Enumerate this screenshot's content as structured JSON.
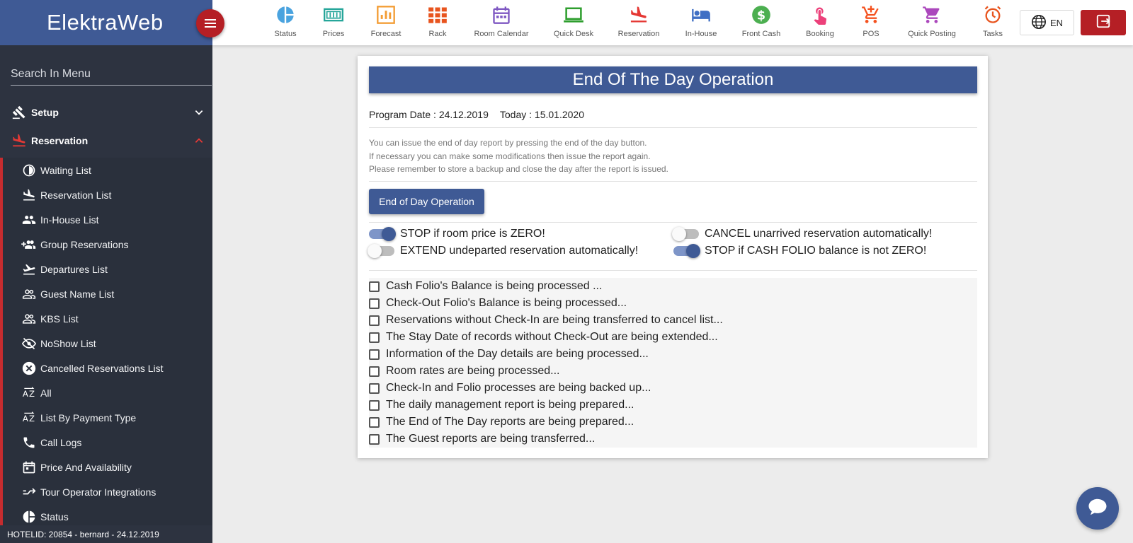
{
  "brand": {
    "name": "ElektraWeb"
  },
  "sidebar": {
    "search_placeholder": "Search In Menu",
    "sections": [
      {
        "label": "Setup",
        "icon": "gavel-icon",
        "expanded": false
      },
      {
        "label": "Reservation",
        "icon": "plane-landing-icon",
        "expanded": true
      }
    ],
    "items": [
      {
        "label": "Waiting List",
        "icon": "clock-half-icon"
      },
      {
        "label": "Reservation List",
        "icon": "plane-landing-icon"
      },
      {
        "label": "In-House List",
        "icon": "people-icon"
      },
      {
        "label": "Group Reservations",
        "icon": "group-add-icon"
      },
      {
        "label": "Departures List",
        "icon": "plane-takeoff-icon"
      },
      {
        "label": "Guest Name List",
        "icon": "people-outline-icon"
      },
      {
        "label": "KBS List",
        "icon": "people-outline-icon"
      },
      {
        "label": "NoShow List",
        "icon": "eye-off-icon"
      },
      {
        "label": "Cancelled Reservations List",
        "icon": "cancel-circle-icon"
      },
      {
        "label": "All",
        "icon": "sort-az-icon"
      },
      {
        "label": "List By Payment Type",
        "icon": "sort-az-icon"
      },
      {
        "label": "Call Logs",
        "icon": "phone-icon"
      },
      {
        "label": "Price And Availability",
        "icon": "calendar-icon"
      },
      {
        "label": "Tour Operator Integrations",
        "icon": "arrows-merge-icon"
      },
      {
        "label": "Status",
        "icon": "pie-icon"
      }
    ],
    "footer": "HOTELID: 20854 - bernard - 24.12.2019"
  },
  "toolbar": {
    "items": [
      {
        "label": "Status",
        "icon": "pie-chart-icon",
        "color": "#4aa3df"
      },
      {
        "label": "Prices",
        "icon": "price-tag-icon",
        "color": "#26a69a"
      },
      {
        "label": "Forecast",
        "icon": "bar-chart-icon",
        "color": "#f39c33"
      },
      {
        "label": "Rack",
        "icon": "grid-icon",
        "color": "#e8541e"
      },
      {
        "label": "Room Calendar",
        "icon": "calendar-icon",
        "color": "#7e57c2"
      },
      {
        "label": "Quick Desk",
        "icon": "laptop-icon",
        "color": "#2e9e2e"
      },
      {
        "label": "Reservation",
        "icon": "plane-landing-icon",
        "color": "#e53935"
      },
      {
        "label": "In-House",
        "icon": "bed-icon",
        "color": "#3f6fc4"
      },
      {
        "label": "Front Cash",
        "icon": "dollar-coin-icon",
        "color": "#4caf50"
      },
      {
        "label": "Booking",
        "icon": "touch-icon",
        "color": "#ec407a"
      },
      {
        "label": "POS",
        "icon": "cart-add-icon",
        "color": "#f4511e"
      },
      {
        "label": "Quick Posting",
        "icon": "cart-icon",
        "color": "#ab47bc"
      },
      {
        "label": "Tasks",
        "icon": "alarm-icon",
        "color": "#e8541e"
      }
    ],
    "language": "EN"
  },
  "card": {
    "title": "End Of The Day Operation",
    "program_date": "Program Date : 24.12.2019",
    "today": "Today : 15.01.2020",
    "info_lines": [
      "You can issue the end of day report by pressing the end of the day button.",
      "If necessary you can make some modifications then issue the report again.",
      "Please remember to store a backup and close the day after the report is issued."
    ],
    "button": "End of Day Operation",
    "options": [
      {
        "label": "STOP if room price is ZERO!",
        "on": true
      },
      {
        "label": "CANCEL unarrived reservation automatically!",
        "on": false
      },
      {
        "label": "EXTEND undeparted reservation automatically!",
        "on": false
      },
      {
        "label": "STOP if CASH FOLIO balance is not ZERO!",
        "on": true
      }
    ],
    "steps": [
      "Cash Folio's Balance is being processed ...",
      "Check-Out Folio's Balance is being processed...",
      "Reservations without Check-In are being transferred to cancel list...",
      "The Stay Date of records without Check-Out are being extended...",
      "Information of the Day details are being processed...",
      "Room rates are being processed...",
      "Check-In and Folio processes are being backed up...",
      "The daily management report is being prepared...",
      "The End of The Day reports are being prepared...",
      "The Guest reports are being transferred..."
    ]
  },
  "colors": {
    "brand": "#3f5a95",
    "accent_red": "#b51f25",
    "sidebar": "#2d3340"
  }
}
